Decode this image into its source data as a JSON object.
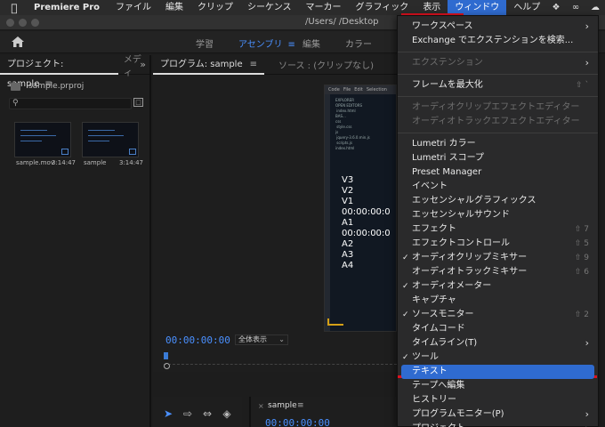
{
  "menubar": {
    "app": "Premiere Pro",
    "items": [
      "ファイル",
      "編集",
      "クリップ",
      "シーケンス",
      "マーカー",
      "グラフィック",
      "表示",
      "ウィンドウ",
      "ヘルプ"
    ],
    "active_index": 7
  },
  "window": {
    "title": "/Users/          /Desktop"
  },
  "workspaces": {
    "items": [
      "学習",
      "アセンブリ",
      "編集",
      "カラー"
    ],
    "active": "アセンブリ"
  },
  "project": {
    "tab": "プロジェクト: sample",
    "tab2": "メディ",
    "file": "sample.prproj",
    "items": [
      {
        "name": "sample.mov",
        "duration": "3:14:47"
      },
      {
        "name": "sample",
        "duration": "3:14:47"
      }
    ]
  },
  "program": {
    "tab": "プログラム: sample",
    "source_tab": "ソース : (クリップなし)",
    "timecode": "00:00:00:00",
    "zoom": "全体表示",
    "overlay": [
      "V3",
      "V2",
      "V1 00:00:00:0",
      "A1 00:00:00:0",
      "A2",
      "A3",
      "A4"
    ]
  },
  "timeline": {
    "name": "sample",
    "timecode": "00:00:00:00"
  },
  "menu": {
    "items": [
      {
        "label": "ワークスペース",
        "sub": true
      },
      {
        "label": "Exchange でエクステンションを検索..."
      },
      {
        "sep": true
      },
      {
        "label": "エクステンション",
        "sub": true,
        "disabled": true
      },
      {
        "sep": true
      },
      {
        "label": "フレームを最大化",
        "shortcut": "⇧ `"
      },
      {
        "sep": true
      },
      {
        "label": "オーディオクリップエフェクトエディター",
        "disabled": true
      },
      {
        "label": "オーディオトラックエフェクトエディター",
        "disabled": true
      },
      {
        "sep": true
      },
      {
        "label": "Lumetri カラー"
      },
      {
        "label": "Lumetri スコープ"
      },
      {
        "label": "Preset Manager"
      },
      {
        "label": "イベント"
      },
      {
        "label": "エッセンシャルグラフィックス"
      },
      {
        "label": "エッセンシャルサウンド"
      },
      {
        "label": "エフェクト",
        "shortcut": "⇧ 7"
      },
      {
        "label": "エフェクトコントロール",
        "shortcut": "⇧ 5"
      },
      {
        "label": "オーディオクリップミキサー",
        "shortcut": "⇧ 9",
        "checked": true
      },
      {
        "label": "オーディオトラックミキサー",
        "shortcut": "⇧ 6"
      },
      {
        "label": "オーディオメーター",
        "checked": true
      },
      {
        "label": "キャプチャ"
      },
      {
        "label": "ソースモニター",
        "shortcut": "⇧ 2",
        "checked": true
      },
      {
        "label": "タイムコード"
      },
      {
        "label": "タイムライン(T)",
        "sub": true
      },
      {
        "label": "ツール",
        "checked": true
      },
      {
        "label": "テキスト",
        "highlight": true
      },
      {
        "label": "テープへ編集"
      },
      {
        "label": "ヒストリー"
      },
      {
        "label": "プログラムモニター(P)",
        "sub": true
      },
      {
        "label": "プロジェクト",
        "sub": true
      }
    ]
  }
}
